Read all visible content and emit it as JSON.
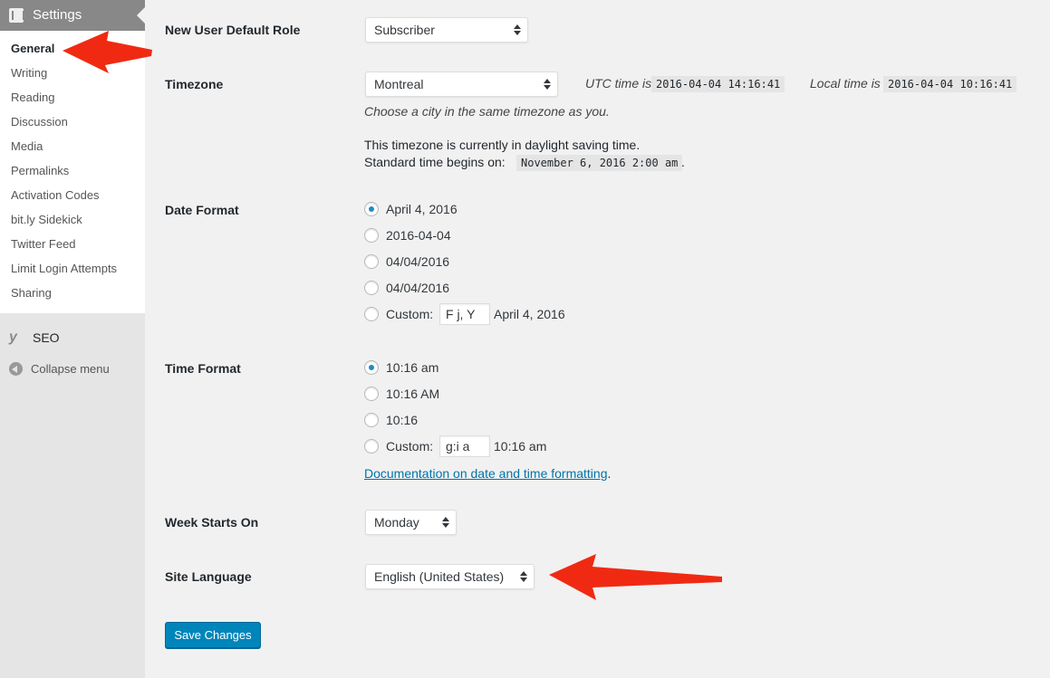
{
  "sidebar": {
    "section_title": "Settings",
    "section_icon": "settings-icon",
    "submenu": [
      {
        "label": "General",
        "current": true
      },
      {
        "label": "Writing"
      },
      {
        "label": "Reading"
      },
      {
        "label": "Discussion"
      },
      {
        "label": "Media"
      },
      {
        "label": "Permalinks"
      },
      {
        "label": "Activation Codes"
      },
      {
        "label": "bit.ly Sidekick"
      },
      {
        "label": "Twitter Feed"
      },
      {
        "label": "Limit Login Attempts"
      },
      {
        "label": "Sharing"
      }
    ],
    "seo_label": "SEO",
    "seo_icon": "yoast-icon",
    "seo_glyph": "y",
    "collapse_label": "Collapse menu",
    "collapse_icon": "collapse-arrow-icon"
  },
  "form": {
    "default_role": {
      "label": "New User Default Role",
      "value": "Subscriber"
    },
    "timezone": {
      "label": "Timezone",
      "value": "Montreal",
      "utc_label": "UTC time is",
      "utc_value": "2016-04-04 14:16:41",
      "local_label": "Local time is",
      "local_value": "2016-04-04 10:16:41",
      "hint": "Choose a city in the same timezone as you.",
      "dst_line": "This timezone is currently in daylight saving time.",
      "standard_label": "Standard time begins on:",
      "standard_value": "November 6, 2016 2:00 am",
      "standard_suffix": "."
    },
    "date_format": {
      "label": "Date Format",
      "options": [
        {
          "label": "April 4, 2016",
          "checked": true
        },
        {
          "label": "2016-04-04"
        },
        {
          "label": "04/04/2016"
        },
        {
          "label": "04/04/2016"
        }
      ],
      "custom_label": "Custom:",
      "custom_value": "F j, Y",
      "custom_preview": "April 4, 2016"
    },
    "time_format": {
      "label": "Time Format",
      "options": [
        {
          "label": "10:16 am",
          "checked": true
        },
        {
          "label": "10:16 AM"
        },
        {
          "label": "10:16"
        }
      ],
      "custom_label": "Custom:",
      "custom_value": "g:i a",
      "custom_preview": "10:16 am",
      "doc_link": "Documentation on date and time formatting",
      "doc_suffix": "."
    },
    "week_start": {
      "label": "Week Starts On",
      "value": "Monday"
    },
    "site_language": {
      "label": "Site Language",
      "value": "English (United States)"
    },
    "save_label": "Save Changes"
  },
  "annotations": {
    "arrow_color": "#f02a12"
  },
  "colors": {
    "primary_button": "#0085ba",
    "link": "#0073aa",
    "radio_checked": "#1e8cbe"
  }
}
